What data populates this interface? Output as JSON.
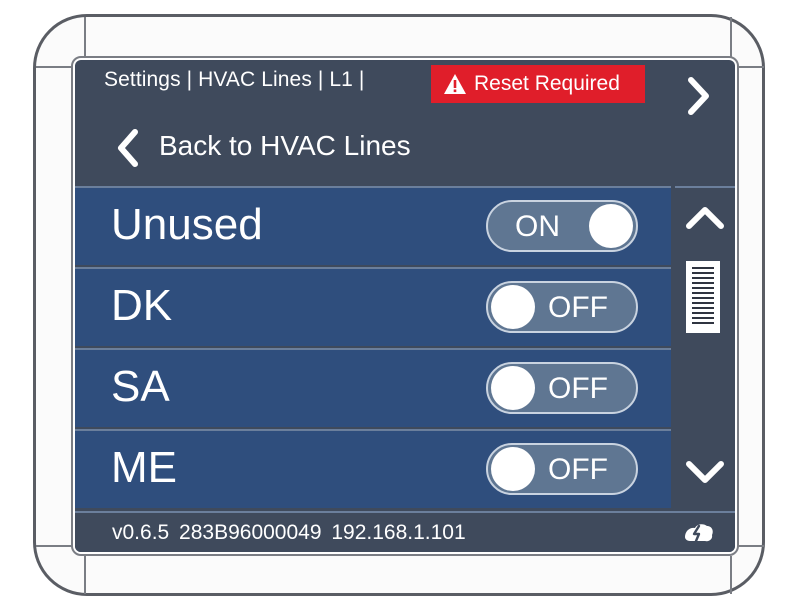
{
  "header": {
    "breadcrumb": "Settings | HVAC Lines | L1 |",
    "alert": "Reset Required"
  },
  "nav": {
    "back_label": "Back to HVAC Lines"
  },
  "lines": [
    {
      "name": "Unused",
      "state": "ON"
    },
    {
      "name": "DK",
      "state": "OFF"
    },
    {
      "name": "SA",
      "state": "OFF"
    },
    {
      "name": "ME",
      "state": "OFF"
    }
  ],
  "footer": {
    "info": "v0.6.5  283B96000049  192.168.1.101"
  },
  "colors": {
    "screen_bg": "#3f4a5c",
    "row_bg": "#2f4e7d",
    "alert_red": "#e01e2a",
    "toggle_bg": "#5f7692"
  },
  "icons": {
    "alert": "warning-triangle-icon",
    "back": "chevron-left-icon",
    "next": "chevron-right-icon",
    "scroll_up": "chevron-up-icon",
    "scroll_down": "chevron-down-icon",
    "status": "connection-status-icon"
  }
}
